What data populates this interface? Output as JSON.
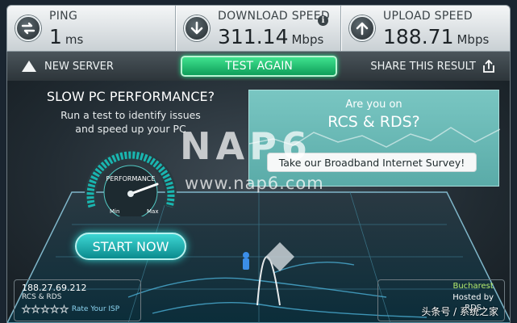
{
  "stats": {
    "ping": {
      "label": "PING",
      "value": "1",
      "unit": "ms",
      "icon": "ping-arrows-icon"
    },
    "download": {
      "label": "DOWNLOAD SPEED",
      "value": "311.14",
      "unit": "Mbps",
      "icon": "download-arrow-icon",
      "info": "i"
    },
    "upload": {
      "label": "UPLOAD SPEED",
      "value": "188.71",
      "unit": "Mbps",
      "icon": "upload-arrow-icon"
    }
  },
  "actions": {
    "new_server": "NEW SERVER",
    "test_again": "TEST AGAIN",
    "share": "SHARE THIS RESULT"
  },
  "promo": {
    "title": "SLOW PC PERFORMANCE?",
    "subtitle_line1": "Run a test to identify issues",
    "subtitle_line2": "and speed up your PC",
    "gauge_label": "PERFORMANCE",
    "gauge_min": "Min",
    "gauge_max": "Max",
    "gauge_level": 0.85,
    "start_button": "START NOW"
  },
  "survey": {
    "question_line1": "Are you on",
    "question_line2": "RCS & RDS?",
    "button": "Take our Broadband Internet Survey!"
  },
  "watermark": {
    "logo": "NAP6",
    "url": "www.nap6.com"
  },
  "isp": {
    "ip": "188.27.69.212",
    "name": "RCS & RDS",
    "stars": 0,
    "star_count": 5,
    "rate_label": "Rate Your ISP"
  },
  "host": {
    "city": "Bucharest",
    "hosted_by": "Hosted by",
    "host_name": "RDS"
  },
  "credit": "头条号 / 系统之家",
  "colors": {
    "accent_green": "#1fb86f",
    "accent_teal": "#1aa9a8",
    "survey_bg": "#6bb9b6"
  }
}
